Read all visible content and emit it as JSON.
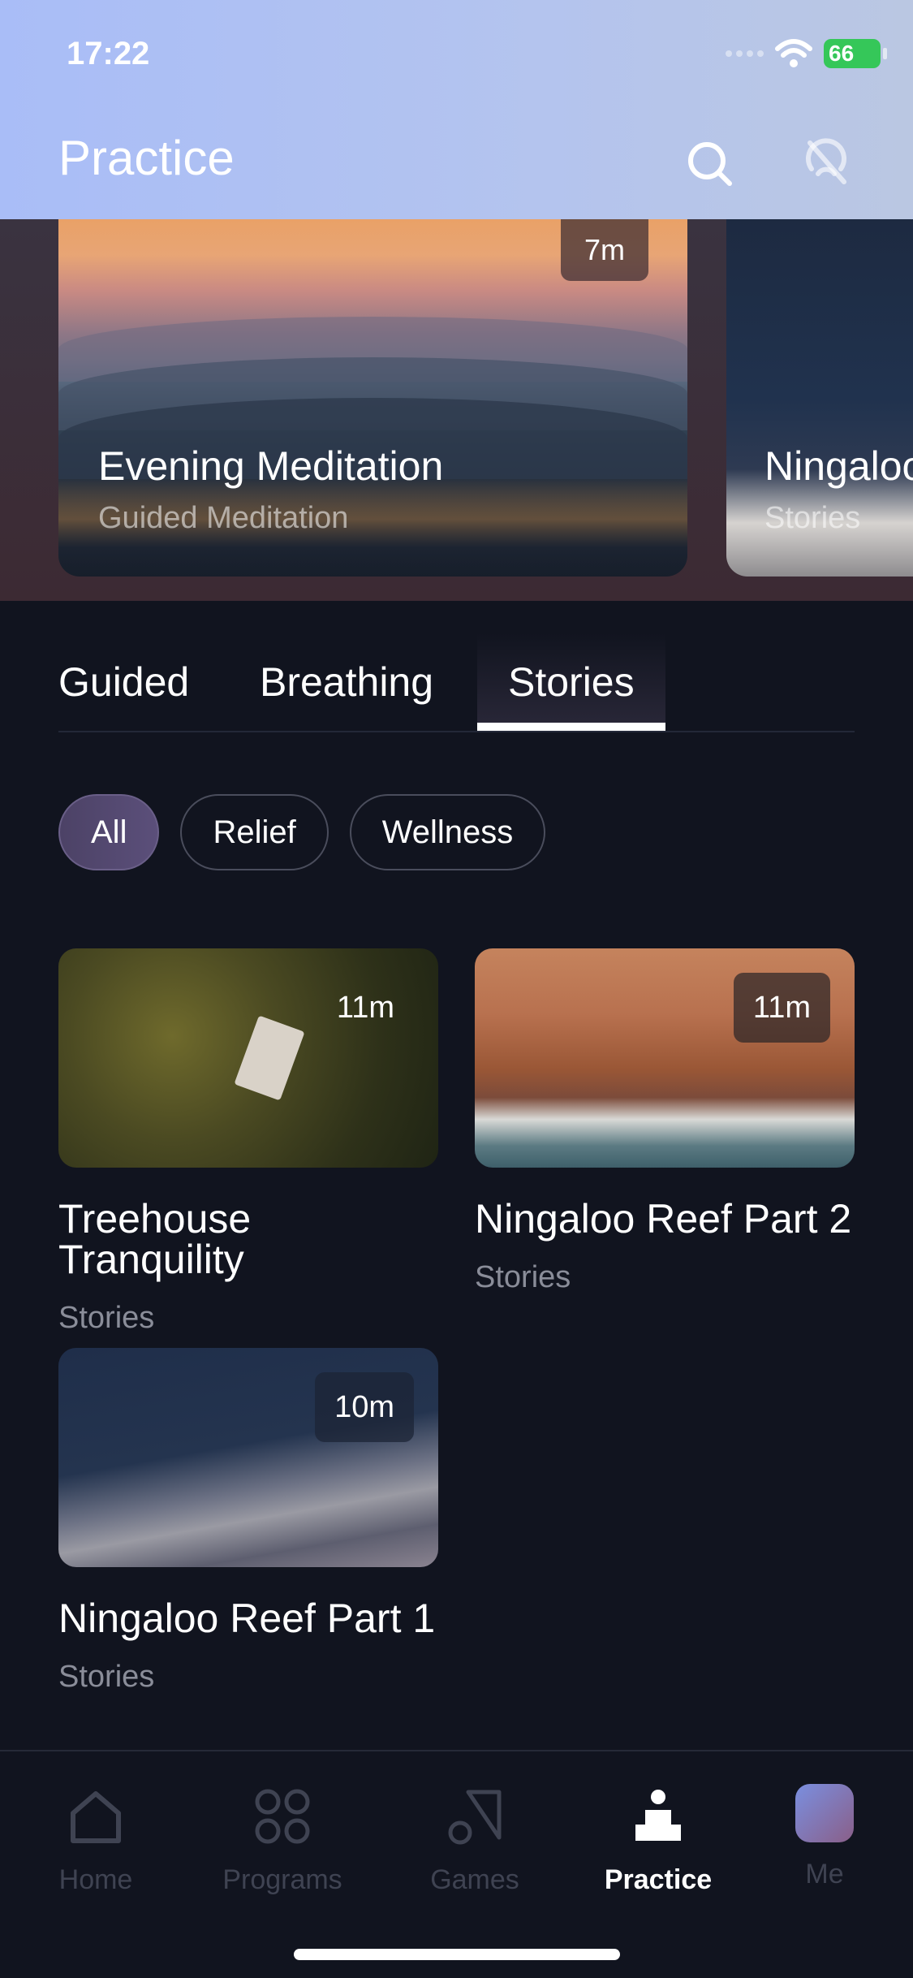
{
  "status_bar": {
    "time": "17:22",
    "battery": "66"
  },
  "header": {
    "title": "Practice",
    "search_icon": "search-icon",
    "airplay_icon": "airplay-off-icon"
  },
  "featured": [
    {
      "title": "Evening Meditation",
      "subtitle": "Guided Meditation",
      "duration": "7m"
    },
    {
      "title": "Ningaloo",
      "subtitle": "Stories"
    }
  ],
  "tabs": [
    "Guided",
    "Breathing",
    "Stories"
  ],
  "active_tab": "Stories",
  "filters": [
    "All",
    "Relief",
    "Wellness"
  ],
  "active_filter": "All",
  "items": [
    {
      "title": "Treehouse Tranquility",
      "category": "Stories",
      "duration": "11m"
    },
    {
      "title": "Ningaloo Reef Part 2",
      "category": "Stories",
      "duration": "11m"
    },
    {
      "title": "Ningaloo Reef Part 1",
      "category": "Stories",
      "duration": "10m"
    }
  ],
  "nav": [
    {
      "label": "Home",
      "icon": "home-icon"
    },
    {
      "label": "Programs",
      "icon": "programs-icon"
    },
    {
      "label": "Games",
      "icon": "games-icon"
    },
    {
      "label": "Practice",
      "icon": "practice-icon"
    },
    {
      "label": "Me",
      "icon": "avatar"
    }
  ],
  "active_nav": "Practice",
  "colors": {
    "background": "#11141f",
    "header_start": "#a9bdf7",
    "chip_active": "#5b4f7a",
    "battery": "#35c759"
  }
}
